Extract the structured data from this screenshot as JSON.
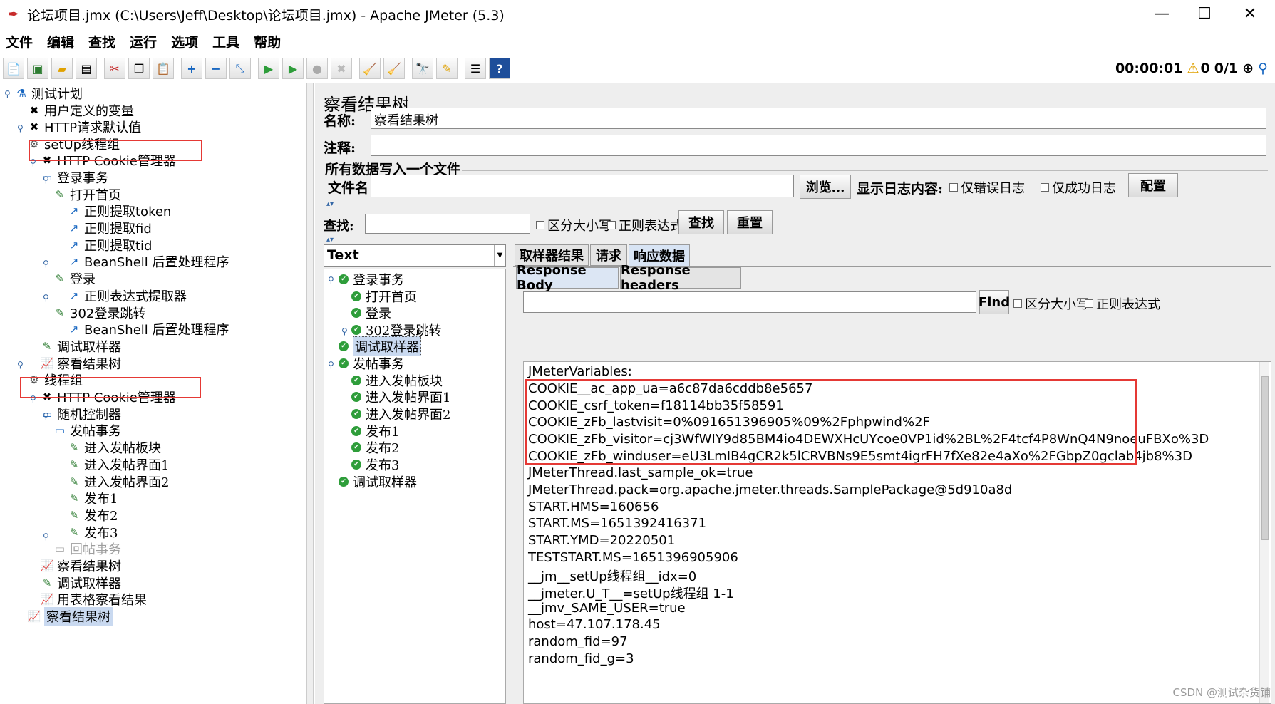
{
  "window": {
    "title": "论坛项目.jmx (C:\\Users\\Jeff\\Desktop\\论坛项目.jmx) - Apache JMeter (5.3)",
    "minimize": "—",
    "maximize": "☐",
    "close": "✕"
  },
  "menu": [
    "文件",
    "编辑",
    "查找",
    "运行",
    "选项",
    "工具",
    "帮助"
  ],
  "toolbar": {
    "icons": [
      "new-icon",
      "templates-icon",
      "open-icon",
      "save-icon",
      "cut-icon",
      "copy-icon",
      "paste-icon",
      "expand-icon",
      "collapse-icon",
      "toggle-icon",
      "start-icon",
      "start-no-pause-icon",
      "stop-icon",
      "shutdown-icon",
      "clear-icon",
      "clear-all-icon",
      "search-icon",
      "reset-search-icon",
      "function-helper-icon",
      "help-icon"
    ],
    "timer": "00:00:01",
    "warnings": "0",
    "threads": "0/1"
  },
  "left_tree": [
    {
      "label": "测试计划",
      "icon": "flask-icon"
    },
    {
      "label": "用户定义的变量",
      "icon": "wrench-icon"
    },
    {
      "label": "HTTP请求默认值",
      "icon": "wrench-icon"
    },
    {
      "label": "setUp线程组",
      "icon": "gear-icon"
    },
    {
      "label": "HTTP Cookie管理器",
      "icon": "wrench-icon"
    },
    {
      "label": "登录事务",
      "icon": "controller-icon"
    },
    {
      "label": "打开首页",
      "icon": "pipette-icon"
    },
    {
      "label": "正则提取token",
      "icon": "post-processor-icon"
    },
    {
      "label": "正则提取fid",
      "icon": "post-processor-icon"
    },
    {
      "label": "正则提取tid",
      "icon": "post-processor-icon"
    },
    {
      "label": "BeanShell 后置处理程序",
      "icon": "post-processor-icon"
    },
    {
      "label": "登录",
      "icon": "pipette-icon"
    },
    {
      "label": "正则表达式提取器",
      "icon": "post-processor-icon"
    },
    {
      "label": "302登录跳转",
      "icon": "pipette-icon"
    },
    {
      "label": "BeanShell 后置处理程序",
      "icon": "post-processor-icon"
    },
    {
      "label": "调试取样器",
      "icon": "pipette-icon"
    },
    {
      "label": "察看结果树",
      "icon": "chart-icon"
    },
    {
      "label": "线程组",
      "icon": "gear-icon"
    },
    {
      "label": "HTTP Cookie管理器",
      "icon": "wrench-icon"
    },
    {
      "label": "随机控制器",
      "icon": "controller-icon"
    },
    {
      "label": "发帖事务",
      "icon": "controller-icon"
    },
    {
      "label": "进入发帖板块",
      "icon": "pipette-icon"
    },
    {
      "label": "进入发帖界面1",
      "icon": "pipette-icon"
    },
    {
      "label": "进入发帖界面2",
      "icon": "pipette-icon"
    },
    {
      "label": "发布1",
      "icon": "pipette-icon"
    },
    {
      "label": "发布2",
      "icon": "pipette-icon"
    },
    {
      "label": "发布3",
      "icon": "pipette-icon"
    },
    {
      "label": "回帖事务",
      "icon": "controller-icon"
    },
    {
      "label": "察看结果树",
      "icon": "chart-icon"
    },
    {
      "label": "调试取样器",
      "icon": "pipette-icon"
    },
    {
      "label": "用表格察看结果",
      "icon": "chart-icon"
    },
    {
      "label": "察看结果树",
      "icon": "chart-icon"
    }
  ],
  "panel": {
    "title": "察看结果树",
    "name_label": "名称:",
    "name_value": "察看结果树",
    "comment_label": "注释:",
    "comment_value": "",
    "fieldset_legend": "所有数据写入一个文件",
    "filename_label": "文件名",
    "filename_value": "",
    "browse_button": "浏览...",
    "log_display_label": "显示日志内容:",
    "errors_only": "仅错误日志",
    "success_only": "仅成功日志",
    "configure_button": "配置",
    "search_label": "查找:",
    "search_value": "",
    "case_sensitive": "区分大小写",
    "regex": "正则表达式",
    "find_button": "查找",
    "reset_button": "重置"
  },
  "result_tree": {
    "renderer": "Text",
    "nodes": [
      {
        "label": "登录事务"
      },
      {
        "label": "打开首页"
      },
      {
        "label": "登录"
      },
      {
        "label": "302登录跳转"
      },
      {
        "label": "调试取样器"
      },
      {
        "label": "发帖事务"
      },
      {
        "label": "进入发帖板块"
      },
      {
        "label": "进入发帖界面1"
      },
      {
        "label": "进入发帖界面2"
      },
      {
        "label": "发布1"
      },
      {
        "label": "发布2"
      },
      {
        "label": "发布3"
      },
      {
        "label": "调试取样器"
      }
    ]
  },
  "tabs": {
    "sampler_result": "取样器结果",
    "request": "请求",
    "response_data": "响应数据",
    "response_body": "Response Body",
    "response_headers": "Response headers",
    "find_button": "Find",
    "case_sensitive": "区分大小写",
    "regex": "正则表达式",
    "find_value": ""
  },
  "response_lines": [
    "JMeterVariables:",
    "COOKIE__ac_app_ua=a6c87da6cddb8e5657",
    "COOKIE_csrf_token=f18114bb35f58591",
    "COOKIE_zFb_lastvisit=0%091651396905%09%2Fphpwind%2F",
    "COOKIE_zFb_visitor=cj3WfWIY9d85BM4io4DEWXHcUYcoe0VP1id%2BL%2F4tcf4P8WnQ4N9noeuFBXo%3D",
    "COOKIE_zFb_winduser=eU3LmIB4gCR2k5lCRVBNs9E5smt4igrFH7fXe82e4aXo%2FGbpZ0gclab4jb8%3D",
    "JMeterThread.last_sample_ok=true",
    "JMeterThread.pack=org.apache.jmeter.threads.SamplePackage@5d910a8d",
    "START.HMS=160656",
    "START.MS=1651392416371",
    "START.YMD=20220501",
    "TESTSTART.MS=1651396905906",
    "__jm__setUp线程组__idx=0",
    "__jmeter.U_T__=setUp线程组 1-1",
    "__jmv_SAME_USER=true",
    "host=47.107.178.45",
    "random_fid=97",
    "random_fid_g=3"
  ],
  "watermark": "CSDN @测试杂货铺",
  "colors": {
    "highlight_box": "#e53935",
    "selection": "#c9d9f0",
    "success_check": "#2e9d3a"
  }
}
